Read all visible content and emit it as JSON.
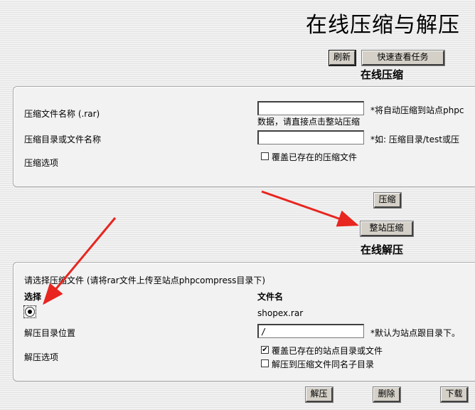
{
  "page": {
    "title": "在线压缩与解压"
  },
  "toolbar": {
    "refresh_label": "刷新",
    "quick_tasks_label": "快速查看任务"
  },
  "compress": {
    "section_title": "在线压缩",
    "archive_name_label": "压缩文件名称 (.rar)",
    "archive_name_value": "",
    "archive_name_hint_line1": "*将自动压缩到站点phpc",
    "archive_name_hint_line2": "数据，请直接点击整站压缩",
    "dir_label": "压缩目录或文件名称",
    "dir_value": "",
    "dir_hint": "*如: 压缩目录/test或压",
    "options_label": "压缩选项",
    "overwrite_label": "覆盖已存在的压缩文件",
    "overwrite_checked": false,
    "compress_button": "压缩",
    "site_compress_button": "整站压缩"
  },
  "extract": {
    "section_title": "在线解压",
    "choose_file_label": "请选择压缩文件 (请将rar文件上传至站点phpcompress目录下)",
    "col_select": "选择",
    "col_filename": "文件名",
    "files": [
      {
        "name": "shopex.rar",
        "selected": true
      }
    ],
    "target_label": "解压目录位置",
    "target_value": "/",
    "target_hint": "*默认为站点跟目录下。",
    "options_label": "解压选项",
    "overwrite_label": "覆盖已存在的站点目录或文件",
    "overwrite_checked": true,
    "subdir_label": "解压到压缩文件同名子目录",
    "subdir_checked": false,
    "extract_button": "解压",
    "delete_button": "删除",
    "download_button": "下载"
  },
  "colors": {
    "annotation_arrow": "#e8251f",
    "button_face": "#d4d0c8"
  }
}
